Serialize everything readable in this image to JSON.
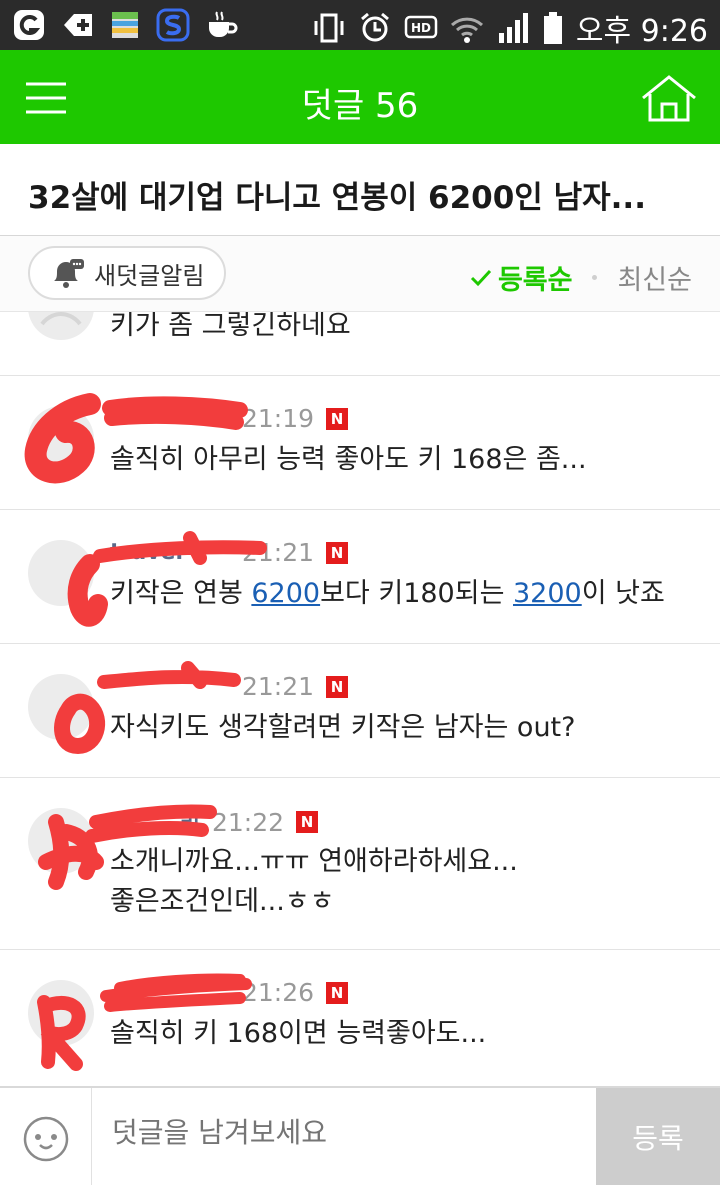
{
  "status_bar": {
    "time": "오후 9:26",
    "left_icons": [
      "app-g-icon",
      "plus-icon",
      "notes-icon",
      "app-s-icon",
      "coffee-icon"
    ],
    "right_icons": [
      "vibrate-icon",
      "alarm-icon",
      "hd-icon",
      "wifi-icon",
      "signal-icon",
      "battery-icon"
    ]
  },
  "app_bar": {
    "title": "덧글 56",
    "menu_icon": "hamburger-menu-icon",
    "home_icon": "home-icon",
    "background": "#1ec800"
  },
  "article": {
    "title": "32살에 대기업 다니고 연봉이 6200인 남자..."
  },
  "sort_bar": {
    "alarm_label": "새덧글알림",
    "active_sort": "등록순",
    "other_sort": "최신순",
    "accent": "#1ec800"
  },
  "comments": [
    {
      "author": "",
      "time": "",
      "badge": "",
      "text": "키가 좀 그렇긴하네요"
    },
    {
      "author": "",
      "time": "21:19",
      "badge": "N",
      "text": "솔직히 아무리 능력 좋아도 키 168은 좀..."
    },
    {
      "author": "travel",
      "time": "21:21",
      "badge": "N",
      "text_before": "키작은 연봉 ",
      "link1": "6200",
      "text_mid": "보다 키180되는 ",
      "link2": "3200",
      "text_after": "이 낫죠"
    },
    {
      "author": "",
      "time": "21:21",
      "badge": "N",
      "text": "자식키도 생각할려면 키작은 남자는 out?"
    },
    {
      "author": "리",
      "time": "21:22",
      "badge": "N",
      "text": "소개니까요...ㅠㅠ 연애하라하세요...\n좋은조건인데...ㅎㅎ"
    },
    {
      "author": "",
      "time": "21:26",
      "badge": "N",
      "text": "솔직히 키 168이면 능력좋아도..."
    }
  ],
  "input_bar": {
    "placeholder": "덧글을 남겨보세요",
    "submit_label": "등록"
  }
}
